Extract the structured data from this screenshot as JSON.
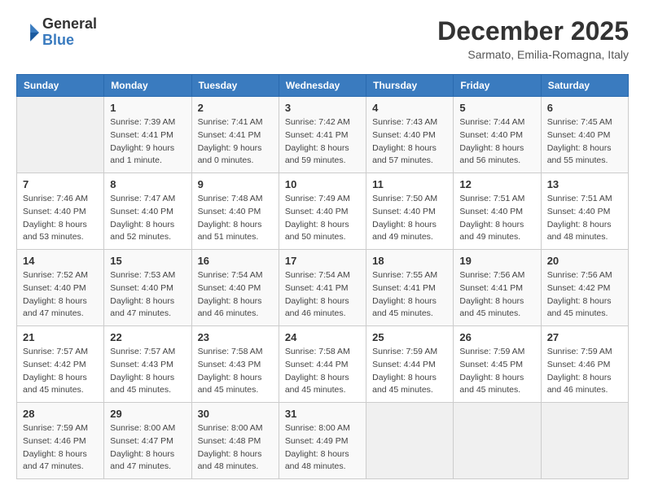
{
  "header": {
    "logo_general": "General",
    "logo_blue": "Blue",
    "month_title": "December 2025",
    "subtitle": "Sarmato, Emilia-Romagna, Italy"
  },
  "weekdays": [
    "Sunday",
    "Monday",
    "Tuesday",
    "Wednesday",
    "Thursday",
    "Friday",
    "Saturday"
  ],
  "weeks": [
    [
      {
        "day": "",
        "sunrise": "",
        "sunset": "",
        "daylight": ""
      },
      {
        "day": "1",
        "sunrise": "Sunrise: 7:39 AM",
        "sunset": "Sunset: 4:41 PM",
        "daylight": "Daylight: 9 hours and 1 minute."
      },
      {
        "day": "2",
        "sunrise": "Sunrise: 7:41 AM",
        "sunset": "Sunset: 4:41 PM",
        "daylight": "Daylight: 9 hours and 0 minutes."
      },
      {
        "day": "3",
        "sunrise": "Sunrise: 7:42 AM",
        "sunset": "Sunset: 4:41 PM",
        "daylight": "Daylight: 8 hours and 59 minutes."
      },
      {
        "day": "4",
        "sunrise": "Sunrise: 7:43 AM",
        "sunset": "Sunset: 4:40 PM",
        "daylight": "Daylight: 8 hours and 57 minutes."
      },
      {
        "day": "5",
        "sunrise": "Sunrise: 7:44 AM",
        "sunset": "Sunset: 4:40 PM",
        "daylight": "Daylight: 8 hours and 56 minutes."
      },
      {
        "day": "6",
        "sunrise": "Sunrise: 7:45 AM",
        "sunset": "Sunset: 4:40 PM",
        "daylight": "Daylight: 8 hours and 55 minutes."
      }
    ],
    [
      {
        "day": "7",
        "sunrise": "Sunrise: 7:46 AM",
        "sunset": "Sunset: 4:40 PM",
        "daylight": "Daylight: 8 hours and 53 minutes."
      },
      {
        "day": "8",
        "sunrise": "Sunrise: 7:47 AM",
        "sunset": "Sunset: 4:40 PM",
        "daylight": "Daylight: 8 hours and 52 minutes."
      },
      {
        "day": "9",
        "sunrise": "Sunrise: 7:48 AM",
        "sunset": "Sunset: 4:40 PM",
        "daylight": "Daylight: 8 hours and 51 minutes."
      },
      {
        "day": "10",
        "sunrise": "Sunrise: 7:49 AM",
        "sunset": "Sunset: 4:40 PM",
        "daylight": "Daylight: 8 hours and 50 minutes."
      },
      {
        "day": "11",
        "sunrise": "Sunrise: 7:50 AM",
        "sunset": "Sunset: 4:40 PM",
        "daylight": "Daylight: 8 hours and 49 minutes."
      },
      {
        "day": "12",
        "sunrise": "Sunrise: 7:51 AM",
        "sunset": "Sunset: 4:40 PM",
        "daylight": "Daylight: 8 hours and 49 minutes."
      },
      {
        "day": "13",
        "sunrise": "Sunrise: 7:51 AM",
        "sunset": "Sunset: 4:40 PM",
        "daylight": "Daylight: 8 hours and 48 minutes."
      }
    ],
    [
      {
        "day": "14",
        "sunrise": "Sunrise: 7:52 AM",
        "sunset": "Sunset: 4:40 PM",
        "daylight": "Daylight: 8 hours and 47 minutes."
      },
      {
        "day": "15",
        "sunrise": "Sunrise: 7:53 AM",
        "sunset": "Sunset: 4:40 PM",
        "daylight": "Daylight: 8 hours and 47 minutes."
      },
      {
        "day": "16",
        "sunrise": "Sunrise: 7:54 AM",
        "sunset": "Sunset: 4:40 PM",
        "daylight": "Daylight: 8 hours and 46 minutes."
      },
      {
        "day": "17",
        "sunrise": "Sunrise: 7:54 AM",
        "sunset": "Sunset: 4:41 PM",
        "daylight": "Daylight: 8 hours and 46 minutes."
      },
      {
        "day": "18",
        "sunrise": "Sunrise: 7:55 AM",
        "sunset": "Sunset: 4:41 PM",
        "daylight": "Daylight: 8 hours and 45 minutes."
      },
      {
        "day": "19",
        "sunrise": "Sunrise: 7:56 AM",
        "sunset": "Sunset: 4:41 PM",
        "daylight": "Daylight: 8 hours and 45 minutes."
      },
      {
        "day": "20",
        "sunrise": "Sunrise: 7:56 AM",
        "sunset": "Sunset: 4:42 PM",
        "daylight": "Daylight: 8 hours and 45 minutes."
      }
    ],
    [
      {
        "day": "21",
        "sunrise": "Sunrise: 7:57 AM",
        "sunset": "Sunset: 4:42 PM",
        "daylight": "Daylight: 8 hours and 45 minutes."
      },
      {
        "day": "22",
        "sunrise": "Sunrise: 7:57 AM",
        "sunset": "Sunset: 4:43 PM",
        "daylight": "Daylight: 8 hours and 45 minutes."
      },
      {
        "day": "23",
        "sunrise": "Sunrise: 7:58 AM",
        "sunset": "Sunset: 4:43 PM",
        "daylight": "Daylight: 8 hours and 45 minutes."
      },
      {
        "day": "24",
        "sunrise": "Sunrise: 7:58 AM",
        "sunset": "Sunset: 4:44 PM",
        "daylight": "Daylight: 8 hours and 45 minutes."
      },
      {
        "day": "25",
        "sunrise": "Sunrise: 7:59 AM",
        "sunset": "Sunset: 4:44 PM",
        "daylight": "Daylight: 8 hours and 45 minutes."
      },
      {
        "day": "26",
        "sunrise": "Sunrise: 7:59 AM",
        "sunset": "Sunset: 4:45 PM",
        "daylight": "Daylight: 8 hours and 45 minutes."
      },
      {
        "day": "27",
        "sunrise": "Sunrise: 7:59 AM",
        "sunset": "Sunset: 4:46 PM",
        "daylight": "Daylight: 8 hours and 46 minutes."
      }
    ],
    [
      {
        "day": "28",
        "sunrise": "Sunrise: 7:59 AM",
        "sunset": "Sunset: 4:46 PM",
        "daylight": "Daylight: 8 hours and 47 minutes."
      },
      {
        "day": "29",
        "sunrise": "Sunrise: 8:00 AM",
        "sunset": "Sunset: 4:47 PM",
        "daylight": "Daylight: 8 hours and 47 minutes."
      },
      {
        "day": "30",
        "sunrise": "Sunrise: 8:00 AM",
        "sunset": "Sunset: 4:48 PM",
        "daylight": "Daylight: 8 hours and 48 minutes."
      },
      {
        "day": "31",
        "sunrise": "Sunrise: 8:00 AM",
        "sunset": "Sunset: 4:49 PM",
        "daylight": "Daylight: 8 hours and 48 minutes."
      },
      {
        "day": "",
        "sunrise": "",
        "sunset": "",
        "daylight": ""
      },
      {
        "day": "",
        "sunrise": "",
        "sunset": "",
        "daylight": ""
      },
      {
        "day": "",
        "sunrise": "",
        "sunset": "",
        "daylight": ""
      }
    ]
  ]
}
